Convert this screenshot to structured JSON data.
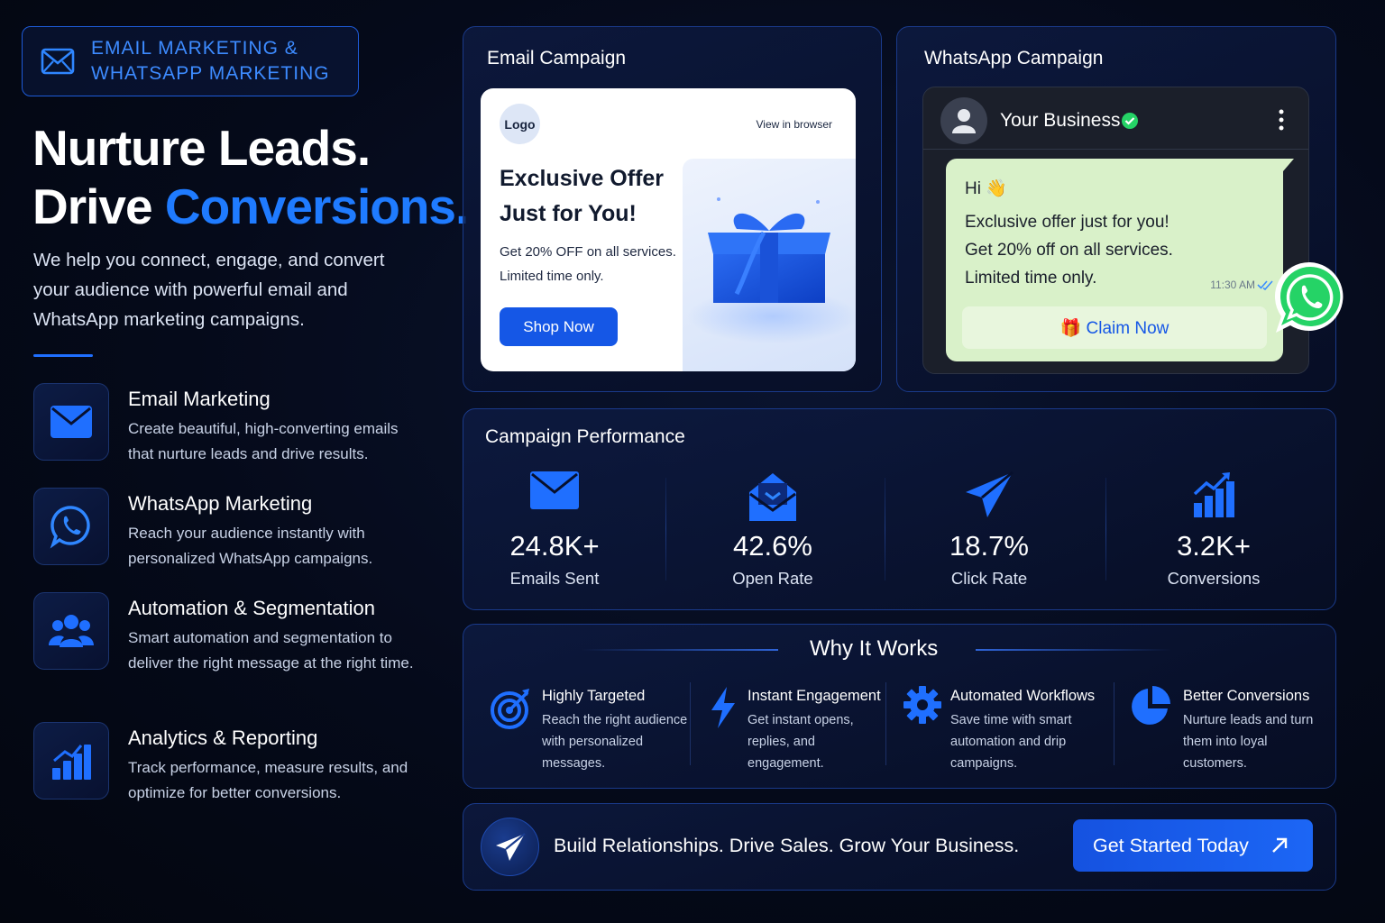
{
  "badge": {
    "line1": "EMAIL MARKETING &",
    "line2": "WHATSAPP MARKETING",
    "icon": "mail-icon"
  },
  "hero": {
    "line1": "Nurture Leads.",
    "line2_prefix": "Drive ",
    "line2_accent": "Conversions."
  },
  "subtitle": "We help you connect, engage, and convert your audience with powerful email and WhatsApp marketing campaigns.",
  "features": [
    {
      "icon": "mail-icon",
      "title": "Email Marketing",
      "desc": "Create beautiful, high-converting emails that nurture leads and drive results."
    },
    {
      "icon": "whatsapp-icon",
      "title": "WhatsApp Marketing",
      "desc": "Reach your audience instantly with personalized WhatsApp campaigns."
    },
    {
      "icon": "users-icon",
      "title": "Automation & Segmentation",
      "desc": "Smart automation and segmentation to deliver the right message at the right time."
    },
    {
      "icon": "bar-chart-icon",
      "title": "Analytics & Reporting",
      "desc": "Track performance, measure results, and optimize for better conversions."
    }
  ],
  "email_campaign": {
    "title": "Email Campaign",
    "logo": "Logo",
    "view_in_browser": "View in browser",
    "offer_line1": "Exclusive Offer",
    "offer_line2": "Just for You!",
    "body_line1": "Get 20% OFF on all services.",
    "body_line2": "Limited time only.",
    "cta": "Shop Now"
  },
  "whatsapp_campaign": {
    "title": "WhatsApp Campaign",
    "business_name": "Your Business",
    "greeting": "Hi 👋",
    "line1": "Exclusive offer just for you!",
    "line2": "Get 20% off on all services.",
    "line3": "Limited time only.",
    "time": "11:30 AM",
    "claim": "🎁 Claim Now"
  },
  "performance": {
    "title": "Campaign Performance",
    "stats": [
      {
        "icon": "mail-icon",
        "value": "24.8K+",
        "label": "Emails Sent"
      },
      {
        "icon": "open-mail-icon",
        "value": "42.6%",
        "label": "Open Rate"
      },
      {
        "icon": "paper-plane-icon",
        "value": "18.7%",
        "label": "Click Rate"
      },
      {
        "icon": "growth-chart-icon",
        "value": "3.2K+",
        "label": "Conversions"
      }
    ]
  },
  "why": {
    "title": "Why It Works",
    "items": [
      {
        "icon": "target-icon",
        "title": "Highly Targeted",
        "desc": "Reach the right audience with personalized messages."
      },
      {
        "icon": "lightning-icon",
        "title": "Instant Engagement",
        "desc": "Get instant opens, replies, and engagement."
      },
      {
        "icon": "gear-icon",
        "title": "Automated Workflows",
        "desc": "Save time with smart automation and drip campaigns."
      },
      {
        "icon": "pie-chart-icon",
        "title": "Better Conversions",
        "desc": "Nurture leads and turn them into loyal customers."
      }
    ]
  },
  "cta": {
    "text": "Build Relationships. Drive Sales. Grow Your Business.",
    "button": "Get Started Today"
  },
  "colors": {
    "accent": "#1f7bff",
    "background": "#050a1a",
    "whatsapp_green": "#25d366",
    "bubble": "#d9f1c9"
  }
}
